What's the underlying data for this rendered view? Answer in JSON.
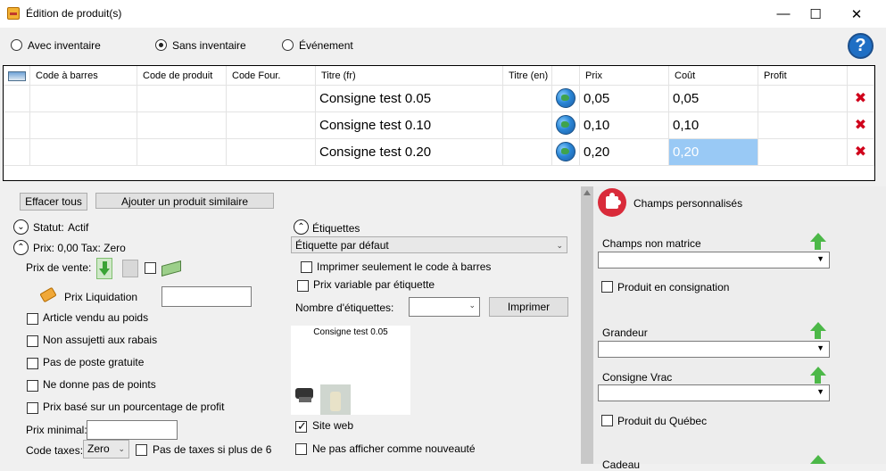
{
  "window": {
    "title": "Édition de produit(s)",
    "controls": {
      "minimize": "—",
      "maximize": "☐",
      "close": "✕"
    }
  },
  "mode": {
    "options": [
      "Avec inventaire",
      "Sans inventaire",
      "Événement"
    ],
    "selected": "Sans inventaire"
  },
  "help_label": "?",
  "grid": {
    "headers": [
      "Code à barres",
      "Code de produit",
      "Code Four.",
      "Titre (fr)",
      "Titre (en)",
      "Prix",
      "Coût",
      "Profit"
    ],
    "rows": [
      {
        "title_fr": "Consigne test 0.05",
        "prix": "0,05",
        "cout": "0,05"
      },
      {
        "title_fr": "Consigne test 0.10",
        "prix": "0,10",
        "cout": "0,10"
      },
      {
        "title_fr": "Consigne test 0.20",
        "prix": "0,20",
        "cout": "0,20"
      }
    ],
    "delete_glyph": "✖"
  },
  "toolbar": {
    "clear_label": "Effacer tous",
    "add_similar_label": "Ajouter un produit similaire"
  },
  "status": {
    "label": "Statut:",
    "value": "Actif"
  },
  "price_summary": {
    "text": "Prix: 0,00  Tax: Zero"
  },
  "sale_price": {
    "label": "Prix de vente:"
  },
  "liquidation": {
    "label": "Prix Liquidation",
    "value": ""
  },
  "checkboxes_left": [
    "Article vendu au poids",
    "Non assujetti aux rabais",
    "Pas de poste gratuite",
    "Ne donne pas de points",
    "Prix basé sur un pourcentage de profit"
  ],
  "min_price": {
    "label": "Prix minimal:",
    "value": ""
  },
  "tax_code": {
    "label": "Code taxes:",
    "value": "Zero",
    "no_tax_label": "Pas de taxes si plus de 6"
  },
  "labels_section": {
    "title": "Étiquettes",
    "template": "Étiquette par défaut",
    "print_barcode_only": "Imprimer seulement le code à barres",
    "variable_price": "Prix variable par étiquette",
    "count_label": "Nombre d'étiquettes:",
    "count_value": "",
    "print_button": "Imprimer",
    "preview_title": "Consigne test 0.05"
  },
  "web": {
    "site_web": "Site web",
    "site_web_checked": true,
    "not_new": "Ne pas afficher comme nouveauté"
  },
  "custom_fields": {
    "title": "Champs personnalisés",
    "fields": [
      {
        "label": "Champs non matrice"
      },
      {
        "checkbox": "Produit en consignation"
      },
      {
        "label": "Grandeur"
      },
      {
        "label": "Consigne Vrac"
      },
      {
        "checkbox": "Produit du Québec"
      }
    ],
    "partial_label": "Cadeau"
  },
  "colors": {
    "selected_cell": "#99c9f5",
    "delete": "#d0021b",
    "help": "#1f6fc4",
    "green_arrow": "#4cb848",
    "puzzle": "#d92b3a"
  }
}
